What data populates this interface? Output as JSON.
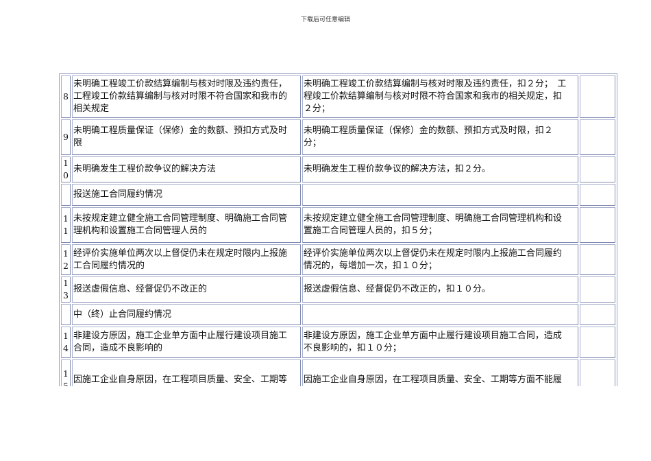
{
  "header": {
    "text": "下载后可任意编辑"
  },
  "rows": [
    {
      "num": "8",
      "item": "未明确工程竣工价款结算编制与核对时限及违约责任，\n工程竣工价款结算编制与核对时限不符合国家和我市的\n相关规定",
      "rule": "未明确工程竣工价款结算编制与核对时限及违约责任，扣２分；　工\n程竣工价款结算编制与核对时限不符合国家和我市的相关规定，扣\n２分；",
      "score": ""
    },
    {
      "num": "9",
      "item": "未明确工程质量保证（保修）金的数额、预扣方式及时\n限",
      "rule": "未明确工程质量保证（保修）金的数额、预扣方式及时限，扣２\n分；",
      "score": ""
    },
    {
      "num": "10",
      "item": "未明确发生工程价款争议的解决方法",
      "rule": "未明确发生工程价款争议的解决方法，扣２分。",
      "score": ""
    },
    {
      "num": "",
      "item": "报送施工合同履约情况",
      "rule": "",
      "score": ""
    },
    {
      "num": "11",
      "item": "未按规定建立健全施工合同管理制度、明确施工合同管\n理机构和设置施工合同管理人员的",
      "rule": "未按规定建立健全施工合同管理制度、明确施工合同管理机构和设\n置施工合同管理人员的，扣５分；",
      "score": ""
    },
    {
      "num": "12",
      "item": "经评价实施单位两次以上督促仍未在规定时限内上报施\n工合同履约情况的",
      "rule": "经评价实施单位两次以上督促仍未在规定时限内上报施工合同履约\n情况的，每增加一次，扣１０分；",
      "score": ""
    },
    {
      "num": "13",
      "item": "报送虚假信息、经督促仍不改正的",
      "rule": "报送虚假信息、经督促仍不改正的，扣１０分。",
      "score": ""
    },
    {
      "num": "",
      "item": "中（终）止合同履约情况",
      "rule": "",
      "score": ""
    },
    {
      "num": "14",
      "item": "非建设方原因，施工企业单方面中止履行建设项目施工\n合同，造成不良影响的",
      "rule": "非建设方原因，施工企业单方面中止履行建设项目施工合同，造成\n不良影响的，扣１０分；",
      "score": ""
    },
    {
      "num": "15",
      "item": "因施工企业自身原因，在工程项目质量、安全、工期等",
      "rule": "因施工企业自身原因，在工程项目质量、安全、工期等方面不能履",
      "score": ""
    }
  ]
}
